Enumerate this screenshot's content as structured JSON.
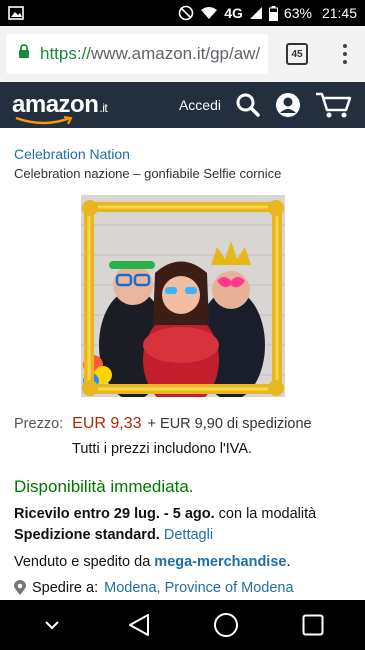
{
  "status_bar": {
    "network": "4G",
    "battery": "63%",
    "time": "21:45",
    "icons": [
      "image-notification-icon",
      "do-not-disturb-icon",
      "wifi-icon",
      "signal-icon",
      "battery-icon"
    ]
  },
  "browser": {
    "url_scheme": "https://",
    "url_rest": "www.amazon.it/gp/aw/",
    "tab_count": "45",
    "icons": [
      "lock-icon",
      "overflow-menu-icon"
    ]
  },
  "header": {
    "logo": "amazon",
    "logo_tld": ".it",
    "signin": "Accedi",
    "bg_color": "#232f3e",
    "icons": [
      "search-icon",
      "account-icon",
      "cart-icon"
    ]
  },
  "product": {
    "brand": "Celebration Nation",
    "title": "Celebration nazione – gonfiabile Selfie cornice",
    "image_alt": "Gold inflatable selfie frame with three people wearing party props",
    "price_label": "Prezzo:",
    "price": "EUR 9,33",
    "shipping": "+ EUR 9,90 di spedizione",
    "tax_note": "Tutti i prezzi includono l'IVA.",
    "availability": "Disponibilità immediata.",
    "delivery_prefix": "Ricevilo entro 29 lug. - 5 ago.",
    "delivery_mid": " con la modalità ",
    "delivery_method": "Spedizione standard.",
    "details_link": "Dettagli",
    "sold_prefix": "Venduto e spedito da ",
    "seller": "mega-merchandise",
    "sold_suffix": ".",
    "ship_label": "Spedire a:",
    "ship_location": "Modena, Province of Modena",
    "price_color": "#b12704",
    "availability_color": "#007600",
    "link_color": "#1e6fa8"
  },
  "nav": {
    "icons": [
      "chevron-down-icon",
      "back-icon",
      "home-icon",
      "recents-icon"
    ]
  }
}
